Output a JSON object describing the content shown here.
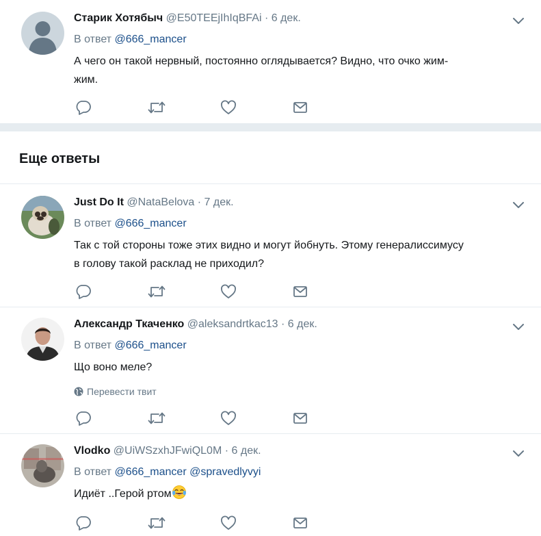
{
  "tweets": [
    {
      "name": "Старик Хотябыч",
      "handle": "@E50TEEjIhIqBFAi",
      "time": "6 дек.",
      "reply_prefix": "В ответ",
      "mentions": [
        "@666_mancer"
      ],
      "lines": [
        "А чего он такой нервный, постоянно оглядывается? Видно, что очко жим-",
        "жим."
      ]
    },
    {
      "name": "Just Do It",
      "handle": "@NataBelova",
      "time": "7 дек.",
      "reply_prefix": "В ответ",
      "mentions": [
        "@666_mancer"
      ],
      "lines": [
        "Так с той стороны тоже этих видно и могут йобнуть. Этому генералиссимусу",
        "в голову такой расклад не приходил?"
      ]
    },
    {
      "name": "Александр Ткаченко",
      "handle": "@aleksandrtkac13",
      "time": "6 дек.",
      "reply_prefix": "В ответ",
      "mentions": [
        "@666_mancer"
      ],
      "lines": [
        "Що воно меле?"
      ],
      "translate": "Перевести твит"
    },
    {
      "name": "Vlodko",
      "handle": "@UiWSzxhJFwiQL0M",
      "time": "6 дек.",
      "reply_prefix": "В ответ",
      "mentions": [
        "@666_mancer",
        "@spravedlyvyi"
      ],
      "lines": [
        "Идиёт ..Герой ртом"
      ],
      "emoji": "face-with-tears-of-joy"
    }
  ],
  "section_title": "Еще ответы",
  "dot": "·",
  "icons": {
    "reply": "reply-icon",
    "retweet": "retweet-icon",
    "like": "heart-icon",
    "dm": "envelope-icon",
    "more": "chevron-down-icon",
    "globe": "globe-icon"
  },
  "colors": {
    "icon": "#657786",
    "mention": "#1b4f8a",
    "divider": "#e6ecf0"
  }
}
